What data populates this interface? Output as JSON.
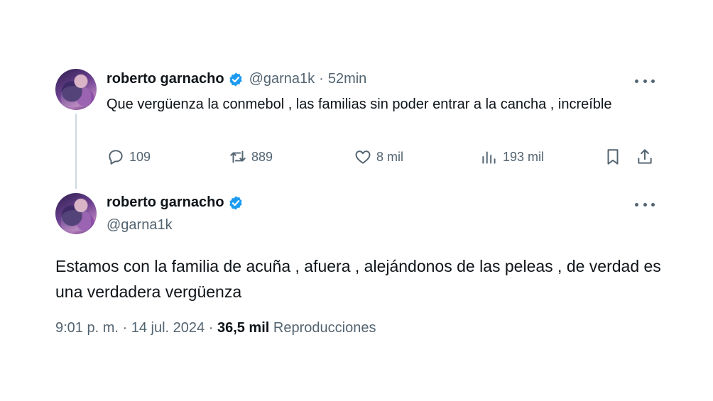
{
  "reply_tweet": {
    "author_name": "roberto garnacho",
    "handle": "@garna1k",
    "separator": "·",
    "time_ago": "52min",
    "text": "Que vergüenza la conmebol , las familias sin poder entrar a la cancha , increíble",
    "replies": "109",
    "retweets": "889",
    "likes": "8 mil",
    "views": "193 mil"
  },
  "main_tweet": {
    "author_name": "roberto garnacho",
    "handle": "@garna1k",
    "text": "Estamos con la familia de acuña , afuera , alejándonos de las peleas , de verdad es una verdadera vergüenza",
    "time": "9:01 p. m.",
    "separator": "·",
    "date": "14 jul. 2024",
    "views_count": "36,5 mil",
    "views_label": "Reproducciones"
  },
  "colors": {
    "verified": "#1d9bf0",
    "secondary_text": "#536471",
    "primary_text": "#0f1419"
  },
  "icons": [
    "verified-badge-icon",
    "more-options-icon",
    "reply-icon",
    "retweet-icon",
    "like-icon",
    "views-icon",
    "bookmark-icon",
    "share-icon"
  ]
}
